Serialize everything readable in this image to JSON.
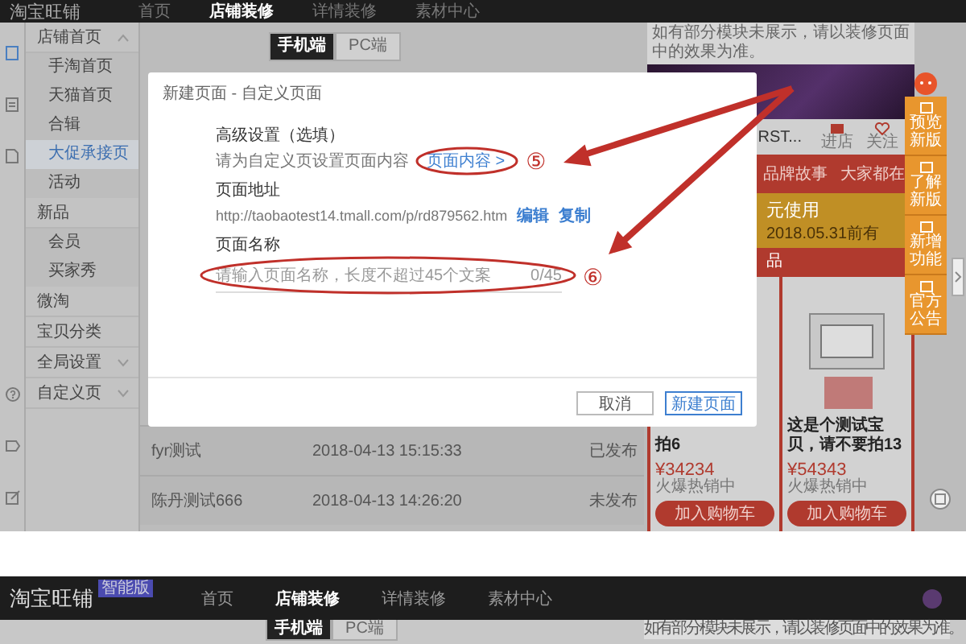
{
  "top_screenshot": {
    "header": {
      "logo": "淘宝旺铺",
      "nav": [
        {
          "label": "首页",
          "selected": false
        },
        {
          "label": "店铺装修",
          "selected": true
        },
        {
          "label": "详情装修",
          "selected": false
        },
        {
          "label": "素材中心",
          "selected": false
        }
      ]
    },
    "device_tabs": [
      {
        "label": "手机端",
        "selected": true
      },
      {
        "label": "PC端",
        "selected": false
      }
    ],
    "sidebar": [
      {
        "label": "店铺首页",
        "selected": false,
        "expanded": true,
        "children": [
          {
            "label": "手淘首页",
            "selected": false
          },
          {
            "label": "天猫首页",
            "selected": false
          },
          {
            "label": "合辑",
            "selected": false
          },
          {
            "label": "大促承接页",
            "selected": true
          },
          {
            "label": "活动",
            "selected": false
          }
        ]
      },
      {
        "label": "新品",
        "selected": false,
        "children": [
          {
            "label": "会员",
            "selected": false
          },
          {
            "label": "买家秀",
            "selected": false
          }
        ]
      },
      {
        "label": "微淘",
        "selected": false
      },
      {
        "label": "宝贝分类",
        "selected": false
      },
      {
        "label": "全局设置",
        "selected": false,
        "expanded": false
      },
      {
        "label": "自定义页",
        "selected": false,
        "expanded": false
      }
    ],
    "table_rows": [
      {
        "name": "fyr测试",
        "time": "2018-04-13 15:15:33",
        "status": "已发布"
      },
      {
        "name": "陈丹测试666",
        "time": "2018-04-13 14:26:20",
        "status": "未发布"
      }
    ],
    "dialog": {
      "title": "新建页面 - 自定义页面",
      "advanced_label": "高级设置（选填）",
      "advanced_hint": "请为自定义页设置页面内容",
      "content_link": "页面内容 >",
      "address_label": "页面地址",
      "address": "http://taobaotest14.tmall.com/p/rd879562.htm",
      "address_actions": [
        "编辑",
        "复制"
      ],
      "name_label": "页面名称",
      "name_field": {
        "placeholder": "请输入页面名称，长度不超过45个文案",
        "counter": "0/45"
      },
      "buttons": [
        {
          "label": "取消",
          "kind": "secondary"
        },
        {
          "label": "新建页面",
          "kind": "primary"
        }
      ]
    },
    "annotations": [
      "⑤",
      "⑥"
    ],
    "preview": {
      "notice": "如有部分模块未展示，请以装修页面中的效果为准。",
      "shop_name": "RST...",
      "shop_actions": [
        "进店",
        "关注"
      ],
      "nav": [
        "品牌故事",
        "大家都在"
      ],
      "coupon": {
        "text": "元使用",
        "date": "2018.05.31前有"
      },
      "section_title": "品",
      "products": [
        {
          "title": "拍6",
          "price": "¥34234",
          "note": "火爆热销中",
          "button": "加入购物车"
        },
        {
          "title": "这是个测试宝贝，请不要拍13",
          "price": "¥54343",
          "note": "火爆热销中",
          "button": "加入购物车"
        }
      ]
    },
    "float_tools": [
      "预览新版",
      "了解新版",
      "新增功能",
      "官方公告"
    ]
  },
  "bottom_screenshot": {
    "header": {
      "logo": "淘宝旺铺",
      "badge": "智能版",
      "nav": [
        {
          "label": "首页",
          "selected": false
        },
        {
          "label": "店铺装修",
          "selected": true
        },
        {
          "label": "详情装修",
          "selected": false
        },
        {
          "label": "素材中心",
          "selected": false
        }
      ]
    },
    "device_tabs": [
      {
        "label": "手机端",
        "selected": true
      },
      {
        "label": "PC端",
        "selected": false
      }
    ],
    "notice": "如有部分模块未展示，请以装修页面中的效果为准。"
  }
}
